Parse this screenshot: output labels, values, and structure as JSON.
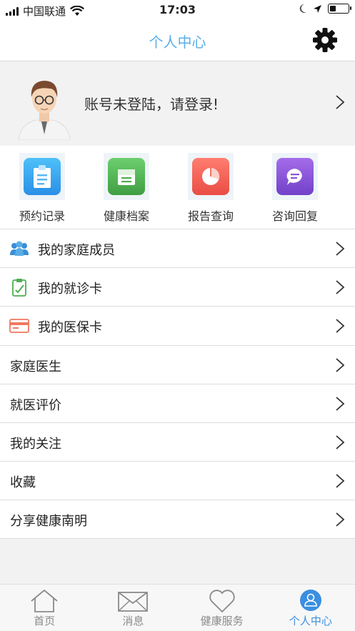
{
  "status_bar": {
    "carrier": "中国联通",
    "time": "17:03",
    "battery_level": 0.35
  },
  "header": {
    "title": "个人中心",
    "settings_icon": "gear-icon"
  },
  "profile": {
    "login_prompt": "账号未登陆，请登录!",
    "avatar_icon": "doctor-avatar-icon"
  },
  "quick_actions": [
    {
      "label": "预约记录",
      "icon": "clipboard-icon",
      "color": "#3aa3f0"
    },
    {
      "label": "健康档案",
      "icon": "folder-icon",
      "color": "#4caf50"
    },
    {
      "label": "报告查询",
      "icon": "pie-chart-icon",
      "color": "#f0605a"
    },
    {
      "label": "咨询回复",
      "icon": "chat-bubble-icon",
      "color": "#8b54d8"
    }
  ],
  "menu": [
    {
      "label": "我的家庭成员",
      "icon": "family-icon"
    },
    {
      "label": "我的就诊卡",
      "icon": "medical-card-icon"
    },
    {
      "label": "我的医保卡",
      "icon": "insurance-card-icon"
    },
    {
      "label": "家庭医生"
    },
    {
      "label": "就医评价"
    },
    {
      "label": "我的关注"
    },
    {
      "label": "收藏"
    },
    {
      "label": "分享健康南明"
    }
  ],
  "tabs": [
    {
      "label": "首页",
      "icon": "home-icon",
      "active": false
    },
    {
      "label": "消息",
      "icon": "envelope-icon",
      "active": false
    },
    {
      "label": "健康服务",
      "icon": "heart-icon",
      "active": false
    },
    {
      "label": "个人中心",
      "icon": "person-icon",
      "active": true
    }
  ],
  "colors": {
    "accent": "#5aaee6",
    "active_tab": "#3b8fe0"
  }
}
